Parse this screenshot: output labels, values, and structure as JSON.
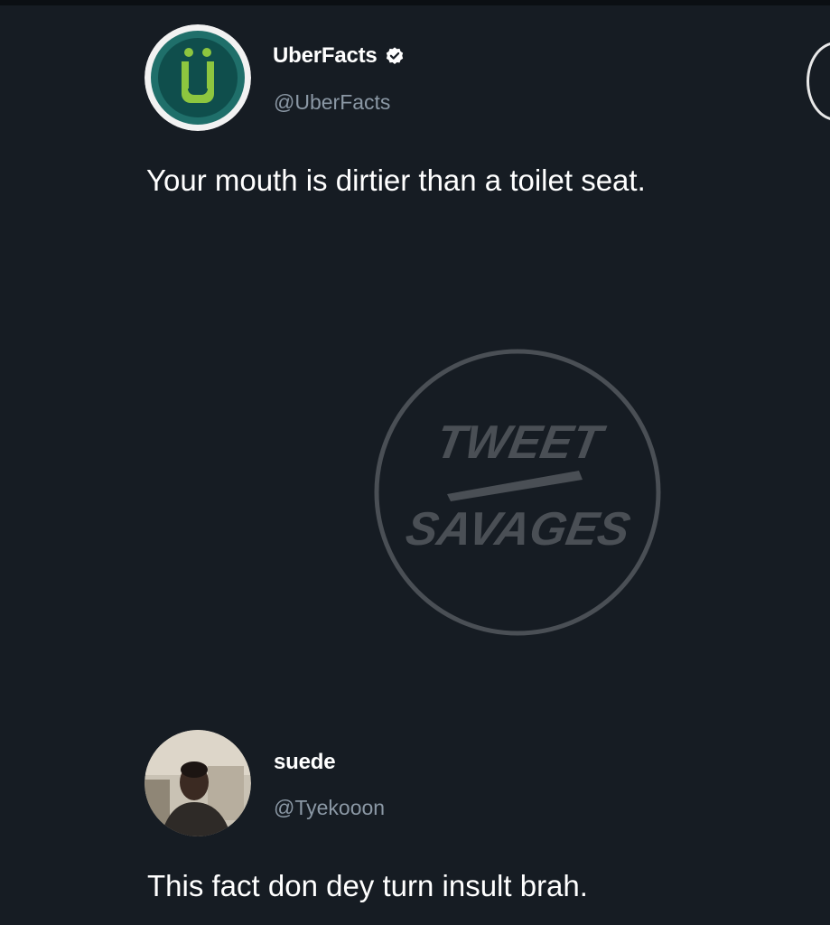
{
  "tweet1": {
    "display_name": "UberFacts",
    "handle": "@UberFacts",
    "verified": true,
    "text": "Your mouth is dirtier than a toilet seat.",
    "avatar_icon": "uberfacts-logo-icon",
    "avatar_letter": "Ü"
  },
  "watermark": {
    "line1": "TWEET",
    "line2": "SAVAGES"
  },
  "tweet2": {
    "display_name": "suede",
    "handle": "@Tyekooon",
    "text": "This fact don dey turn insult brah.",
    "avatar_icon": "user-photo-avatar"
  },
  "colors": {
    "background": "#161c23",
    "text": "#ffffff",
    "handle": "#8b98a5",
    "uberfacts_green": "#8dc63f",
    "uberfacts_teal": "#1f6f6a",
    "watermark": "#4a4f55"
  }
}
